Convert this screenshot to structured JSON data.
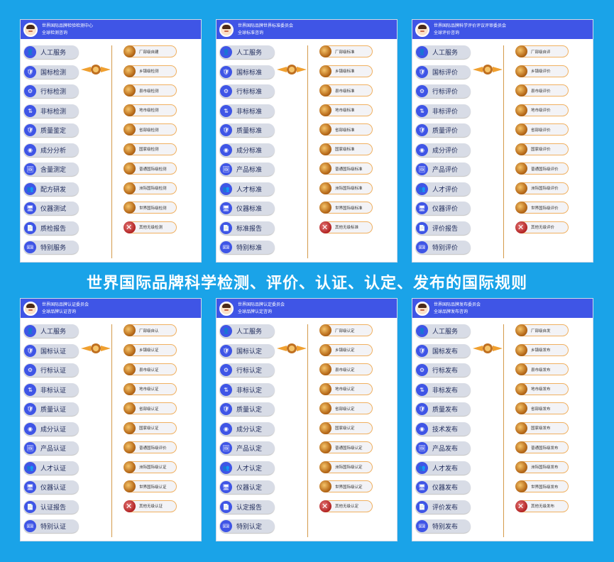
{
  "main_title": "世界国际品牌科学检测、评价、认证、认定、发布的国际规则",
  "colors": {
    "background": "#1aa3e8",
    "header": "#3f55e6",
    "button": "#d8dce6",
    "option_border": "#f0b060"
  },
  "panels": [
    {
      "header_line1": "世界国际品牌检验检测中心",
      "header_line2": "全球检测咨询",
      "buttons": [
        "人工服务",
        "国标检测",
        "行标检测",
        "非标检测",
        "质量鉴定",
        "成分分析",
        "含量测定",
        "配方研发",
        "仪器测试",
        "质检报告",
        "特别服务"
      ],
      "options": [
        "厂部级自建",
        "乡镇级检测",
        "县市级检测",
        "地市级检测",
        "省部级检测",
        "国家级检测",
        "普通国际级检测",
        "洲际国际级检测",
        "世界国际级检测",
        "其他无级检测"
      ]
    },
    {
      "header_line1": "世界国际品牌世界标准委员会",
      "header_line2": "全球标准咨询",
      "buttons": [
        "人工服务",
        "国标标准",
        "行标标准",
        "非标标准",
        "质量标准",
        "成分标准",
        "产品标准",
        "人才标准",
        "仪器标准",
        "标准报告",
        "特别标准"
      ],
      "options": [
        "厂部级标准",
        "乡镇级标准",
        "县市级标准",
        "地市级标准",
        "省部级标准",
        "国家级标准",
        "普通国际级标准",
        "洲际国际级标准",
        "世界国际级标准",
        "其他无级标准"
      ]
    },
    {
      "header_line1": "世界国际品牌科学评价评议评审委员会",
      "header_line2": "全球评价咨询",
      "buttons": [
        "人工服务",
        "国标评价",
        "行标评价",
        "非标评价",
        "质量评价",
        "成分评价",
        "产品评价",
        "人才评价",
        "仪器评价",
        "评价报告",
        "特别评价"
      ],
      "options": [
        "厂部级自评",
        "乡镇级评价",
        "县市级评价",
        "地市级评价",
        "省部级评价",
        "国家级评价",
        "普通国际级评价",
        "洲际国际级评价",
        "世界国际级评价",
        "其他无级评价"
      ]
    },
    {
      "header_line1": "世界国际品牌认证委员会",
      "header_line2": "全球品牌认证咨询",
      "buttons": [
        "人工服务",
        "国标认证",
        "行标认证",
        "非标认证",
        "质量认证",
        "成分认证",
        "产品认证",
        "人才认证",
        "仪器认证",
        "认证报告",
        "特别认证"
      ],
      "options": [
        "厂部级自认",
        "乡镇级认证",
        "县市级认证",
        "地市级认证",
        "省部级认证",
        "国家级认证",
        "普通国际级评价",
        "洲际国际级认证",
        "世界国际级认证",
        "其他无级认证"
      ]
    },
    {
      "header_line1": "世界国际品牌认定委员会",
      "header_line2": "全球品牌认定咨询",
      "buttons": [
        "人工服务",
        "国标认定",
        "行标认定",
        "非标认定",
        "质量认定",
        "成分认定",
        "产品认定",
        "人才认定",
        "仪器认定",
        "认定报告",
        "特别认定"
      ],
      "options": [
        "厂部级认定",
        "乡镇级认定",
        "县市级认定",
        "地市级认定",
        "省部级认定",
        "国家级认定",
        "普通国际级认定",
        "洲际国际级认定",
        "世界国际级认定",
        "其他无级认定"
      ]
    },
    {
      "header_line1": "世界国际品牌发布委员会",
      "header_line2": "全球品牌发布咨询",
      "buttons": [
        "人工服务",
        "国标发布",
        "行标发布",
        "非标发布",
        "质量发布",
        "技术发布",
        "产品发布",
        "人才发布",
        "仪器发布",
        "评价发布",
        "特别发布"
      ],
      "options": [
        "厂部级自发",
        "乡镇级发布",
        "县市级发布",
        "地市级发布",
        "省部级发布",
        "国家级发布",
        "普通国际级发布",
        "洲际国际级发布",
        "世界国际级发布",
        "其他无级发布"
      ]
    }
  ]
}
